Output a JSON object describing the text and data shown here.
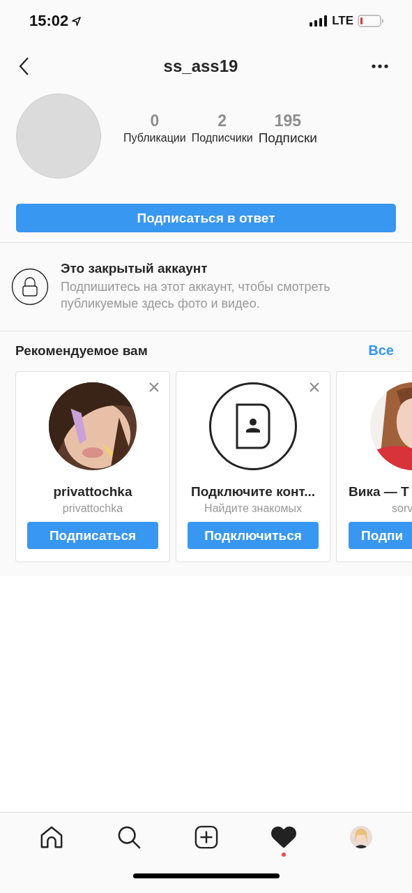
{
  "status_bar": {
    "time": "15:02",
    "network": "LTE"
  },
  "nav": {
    "title": "ss_ass19"
  },
  "profile": {
    "stats": [
      {
        "value": "0",
        "label": "Публикации"
      },
      {
        "value": "2",
        "label": "Подписчики"
      },
      {
        "value": "195",
        "label": "Подписки"
      }
    ],
    "follow_button": "Подписаться в ответ"
  },
  "private_notice": {
    "title": "Это закрытый аккаунт",
    "text": "Подпишитесь на этот аккаунт, чтобы смотреть публикуемые здесь фото и видео."
  },
  "suggestions": {
    "title": "Рекомендуемое вам",
    "see_all": "Все",
    "cards": [
      {
        "kind": "user",
        "name": "privattochka",
        "subtitle": "privattochka",
        "button": "Подписаться",
        "dismissible": true
      },
      {
        "kind": "contacts",
        "name": "Подключите конт...",
        "subtitle": "Найдите знакомых",
        "button": "Подключиться",
        "dismissible": true
      },
      {
        "kind": "user",
        "name": "Вика — Т",
        "subtitle": "sorv",
        "button": "Подпи",
        "dismissible": false
      }
    ]
  },
  "tab_bar": [
    {
      "kind": "home",
      "selected": false,
      "notification": false
    },
    {
      "kind": "search",
      "selected": false,
      "notification": false
    },
    {
      "kind": "add",
      "selected": false,
      "notification": false
    },
    {
      "kind": "activity",
      "selected": true,
      "notification": true
    },
    {
      "kind": "profile",
      "selected": false,
      "notification": false
    }
  ]
}
